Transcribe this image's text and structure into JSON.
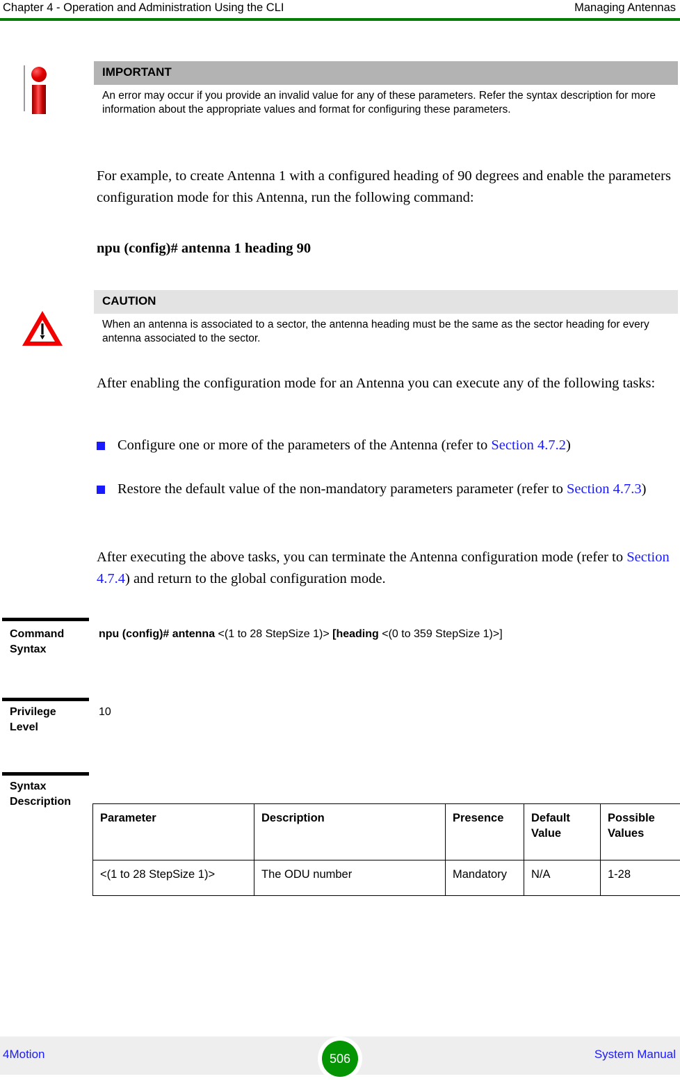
{
  "header": {
    "left": "Chapter 4 - Operation and Administration Using the CLI",
    "right": "Managing Antennas",
    "rule_color": "#007d00"
  },
  "important_box": {
    "title": "IMPORTANT",
    "body": "An error may occur if you provide an invalid value for any of these parameters. Refer the syntax description for more information about the appropriate values and format for configuring these parameters.",
    "bar_color": "#b3b3b3",
    "icon": "info-icon"
  },
  "example_paragraph": {
    "text": "For example, to create Antenna 1 with a configured heading of 90 degrees and enable the parameters configuration mode for this Antenna, run the following command:"
  },
  "example_command": {
    "text": "npu (config)# antenna 1 heading 90"
  },
  "caution_box": {
    "title": "CAUTION",
    "body": "When an antenna is associated to a sector, the antenna heading must be the same as the sector heading for every antenna associated to the sector.",
    "bar_color": "#e3e3e3",
    "icon": "caution-triangle-icon"
  },
  "tasks_intro": {
    "text": "After enabling the configuration mode for an Antenna you can execute any of the following tasks:"
  },
  "task_list": [
    {
      "prefix": "Configure one or more of the parameters of the Antenna (refer to ",
      "link": "Section 4.7.2",
      "suffix": ")"
    },
    {
      "prefix": "Restore the default value of the non-mandatory parameters parameter (refer to ",
      "link": "Section 4.7.3",
      "suffix": ")"
    }
  ],
  "closing_paragraph": {
    "prefix": "After executing the above tasks, you can terminate the Antenna configuration mode (refer to ",
    "link": "Section 4.7.4",
    "suffix": ") and return to the global configuration mode."
  },
  "link_color": "#1a1aff",
  "command_syntax": {
    "label_line1": "Command",
    "label_line2": "Syntax",
    "bold_1": "npu (config)# antenna",
    "plain_1": " <(1 to 28 StepSize 1)> ",
    "bold_2": "[heading",
    "plain_2": "  <(0 to 359 StepSize 1)>]"
  },
  "privilege_level": {
    "label_line1": "Privilege",
    "label_line2": "Level",
    "value": "10"
  },
  "syntax_description": {
    "label_line1": "Syntax",
    "label_line2": "Description",
    "columns": [
      "Parameter",
      "Description",
      "Presence",
      "Default Value",
      "Possible Values"
    ],
    "rows": [
      [
        "<(1 to 28 StepSize 1)>",
        "The ODU number",
        "Mandatory",
        "N/A",
        "1-28"
      ]
    ]
  },
  "footer": {
    "left": "4Motion",
    "page_number": "506",
    "right": "System Manual",
    "badge_color": "#049404",
    "band_color": "#eeeeee"
  }
}
